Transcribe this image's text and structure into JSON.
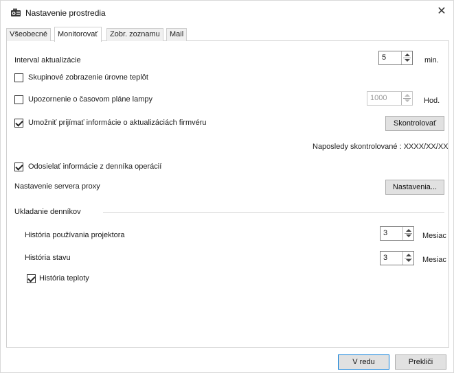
{
  "window": {
    "title": "Nastavenie prostredia"
  },
  "icons": {
    "app": "projector-settings-icon",
    "close": "close-icon"
  },
  "tabs": [
    {
      "label": "Všeobecné",
      "active": false
    },
    {
      "label": "Monitorovať",
      "active": true
    },
    {
      "label": "Zobr. zoznamu",
      "active": false
    },
    {
      "label": "Mail",
      "active": false
    }
  ],
  "monitor": {
    "update_interval": {
      "label": "Interval aktualizácie",
      "value": "5",
      "unit": "min."
    },
    "group_temp": {
      "label": "Skupinové zobrazenie úrovne teplôt",
      "checked": false
    },
    "lamp_warning": {
      "label": "Upozornenie o časovom pláne lampy",
      "checked": false,
      "value": "1000",
      "unit": "Hod."
    },
    "firmware": {
      "label": "Umožniť prijímať informácie o aktualizáciách firmvéru",
      "checked": true,
      "button": "Skontrolovať"
    },
    "last_checked": {
      "text": "Naposledy skontrolované : XXXX/XX/XX"
    },
    "send_log": {
      "label": "Odosielať informácie z denníka operácií",
      "checked": true
    },
    "proxy": {
      "label": "Nastavenie servera proxy",
      "button": "Nastavenia..."
    },
    "log_section": {
      "title": "Ukladanie denníkov"
    },
    "usage_history": {
      "label": "História používania projektora",
      "value": "3",
      "unit": "Mesiac"
    },
    "status_history": {
      "label": "História stavu",
      "value": "3",
      "unit": "Mesiac"
    },
    "temp_history": {
      "label": "História teploty",
      "checked": true
    }
  },
  "footer": {
    "ok": "V redu",
    "cancel": "Prekliči"
  },
  "colors": {
    "accent": "#0078d7",
    "button_bg": "#e1e1e1"
  }
}
